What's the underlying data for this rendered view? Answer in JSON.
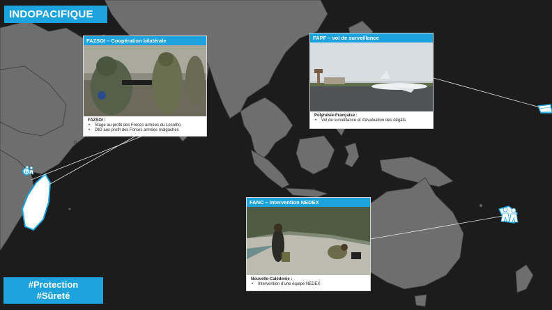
{
  "region_title": "INDOPACIFIQUE",
  "hashtags": [
    "#Protection",
    "#Sûreté"
  ],
  "cards": [
    {
      "id": "fazsoi",
      "header": "FAZSOI – Coopération bilatérale",
      "location": "FAZSOI :",
      "items": [
        "Stage au profit des Forces armées du Lesotho",
        "DIO aux profit des Forces armées malgaches"
      ],
      "photo": "soldiers-rifle-training-photo"
    },
    {
      "id": "fapf",
      "header": "FAPF – vol de surveillance",
      "location": "Polynésie-Française :",
      "items": [
        "Vol de surveillance et d'évaluation des dégâts"
      ],
      "photo": "surveillance-jet-airport-photo"
    },
    {
      "id": "fanc",
      "header": "FANC – Intervention NEDEX",
      "location": "Nouvelle-Calédonie :",
      "items": [
        "Intervention d'une équipe NEDEX"
      ],
      "photo": "nedex-team-beach-photo"
    }
  ],
  "colors": {
    "ocean": "#1c1c1c",
    "land": "#6e6e6e",
    "border": "#3a3a3a",
    "accent": "#1ca3dd",
    "highlight": "#ffffff"
  },
  "icons": [
    "soldiers-icon-madagascar",
    "soldiers-icon-newcaledonia",
    "soldiers-icon-polynesia"
  ]
}
